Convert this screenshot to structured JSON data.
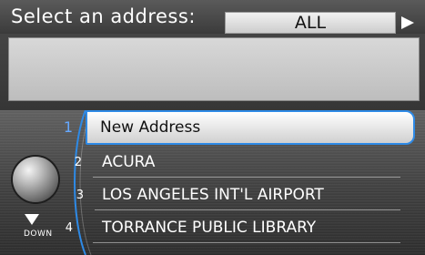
{
  "header": {
    "title": "Select an address:",
    "filter_value": "ALL"
  },
  "list": {
    "items": [
      {
        "number": "1",
        "label": "New Address"
      },
      {
        "number": "2",
        "label": "ACURA"
      },
      {
        "number": "3",
        "label": "LOS ANGELES INT'L AIRPORT"
      },
      {
        "number": "4",
        "label": "TORRANCE PUBLIC LIBRARY"
      }
    ],
    "selected_index": 0
  },
  "controls": {
    "down_label": "DOWN"
  },
  "colors": {
    "highlight": "#2e8ae6",
    "selected_number": "#65a8ff"
  },
  "icons": [
    "play-arrow-icon",
    "down-arrow-icon",
    "knob-icon"
  ]
}
